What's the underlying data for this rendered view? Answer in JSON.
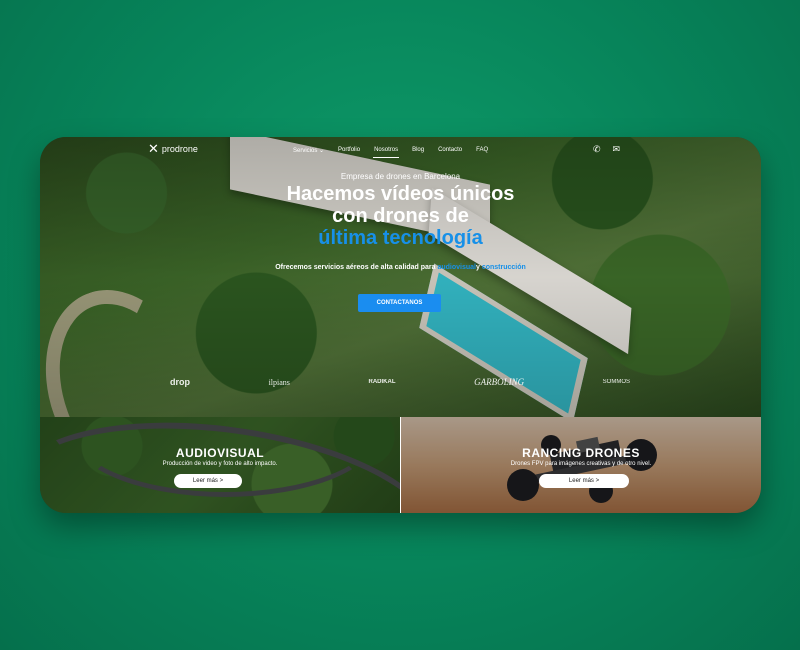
{
  "logo": {
    "mark": "✕",
    "name": "prodrone"
  },
  "nav": {
    "items": [
      {
        "label": "Servicios ⌄"
      },
      {
        "label": "Portfolio"
      },
      {
        "label": "Nosotros"
      },
      {
        "label": "Blog"
      },
      {
        "label": "Contacto"
      },
      {
        "label": "FAQ"
      }
    ],
    "active": "Nosotros",
    "phone_icon": "✆",
    "mail_icon": "✉"
  },
  "hero": {
    "kicker": "Empresa de drones en Barcelona",
    "headline_1": "Hacemos vídeos únicos",
    "headline_2": "con drones de",
    "headline_highlight": "última tecnología",
    "subtitle_prefix": "Ofrecemos servicios aéreos de alta calidad para ",
    "subtitle_link1": "audiovisual",
    "subtitle_mid": "y ",
    "subtitle_link2": "construcción",
    "cta": "CONTACTANOS"
  },
  "clients": [
    "drop",
    "ilpians",
    "RADIKAL",
    "GARBOLING",
    "SOMMOS"
  ],
  "panels": {
    "left": {
      "title": "AUDIOVISUAL",
      "desc": "Producción de video y foto de alto impacto.",
      "button": "Leer más >"
    },
    "right": {
      "title": "RANCING DRONES",
      "desc": "Drones FPV para imágenes creativas y de otro nivel.",
      "button": "Leer más >"
    }
  },
  "colors": {
    "accent": "#1a8df0",
    "background": "#07845a"
  }
}
